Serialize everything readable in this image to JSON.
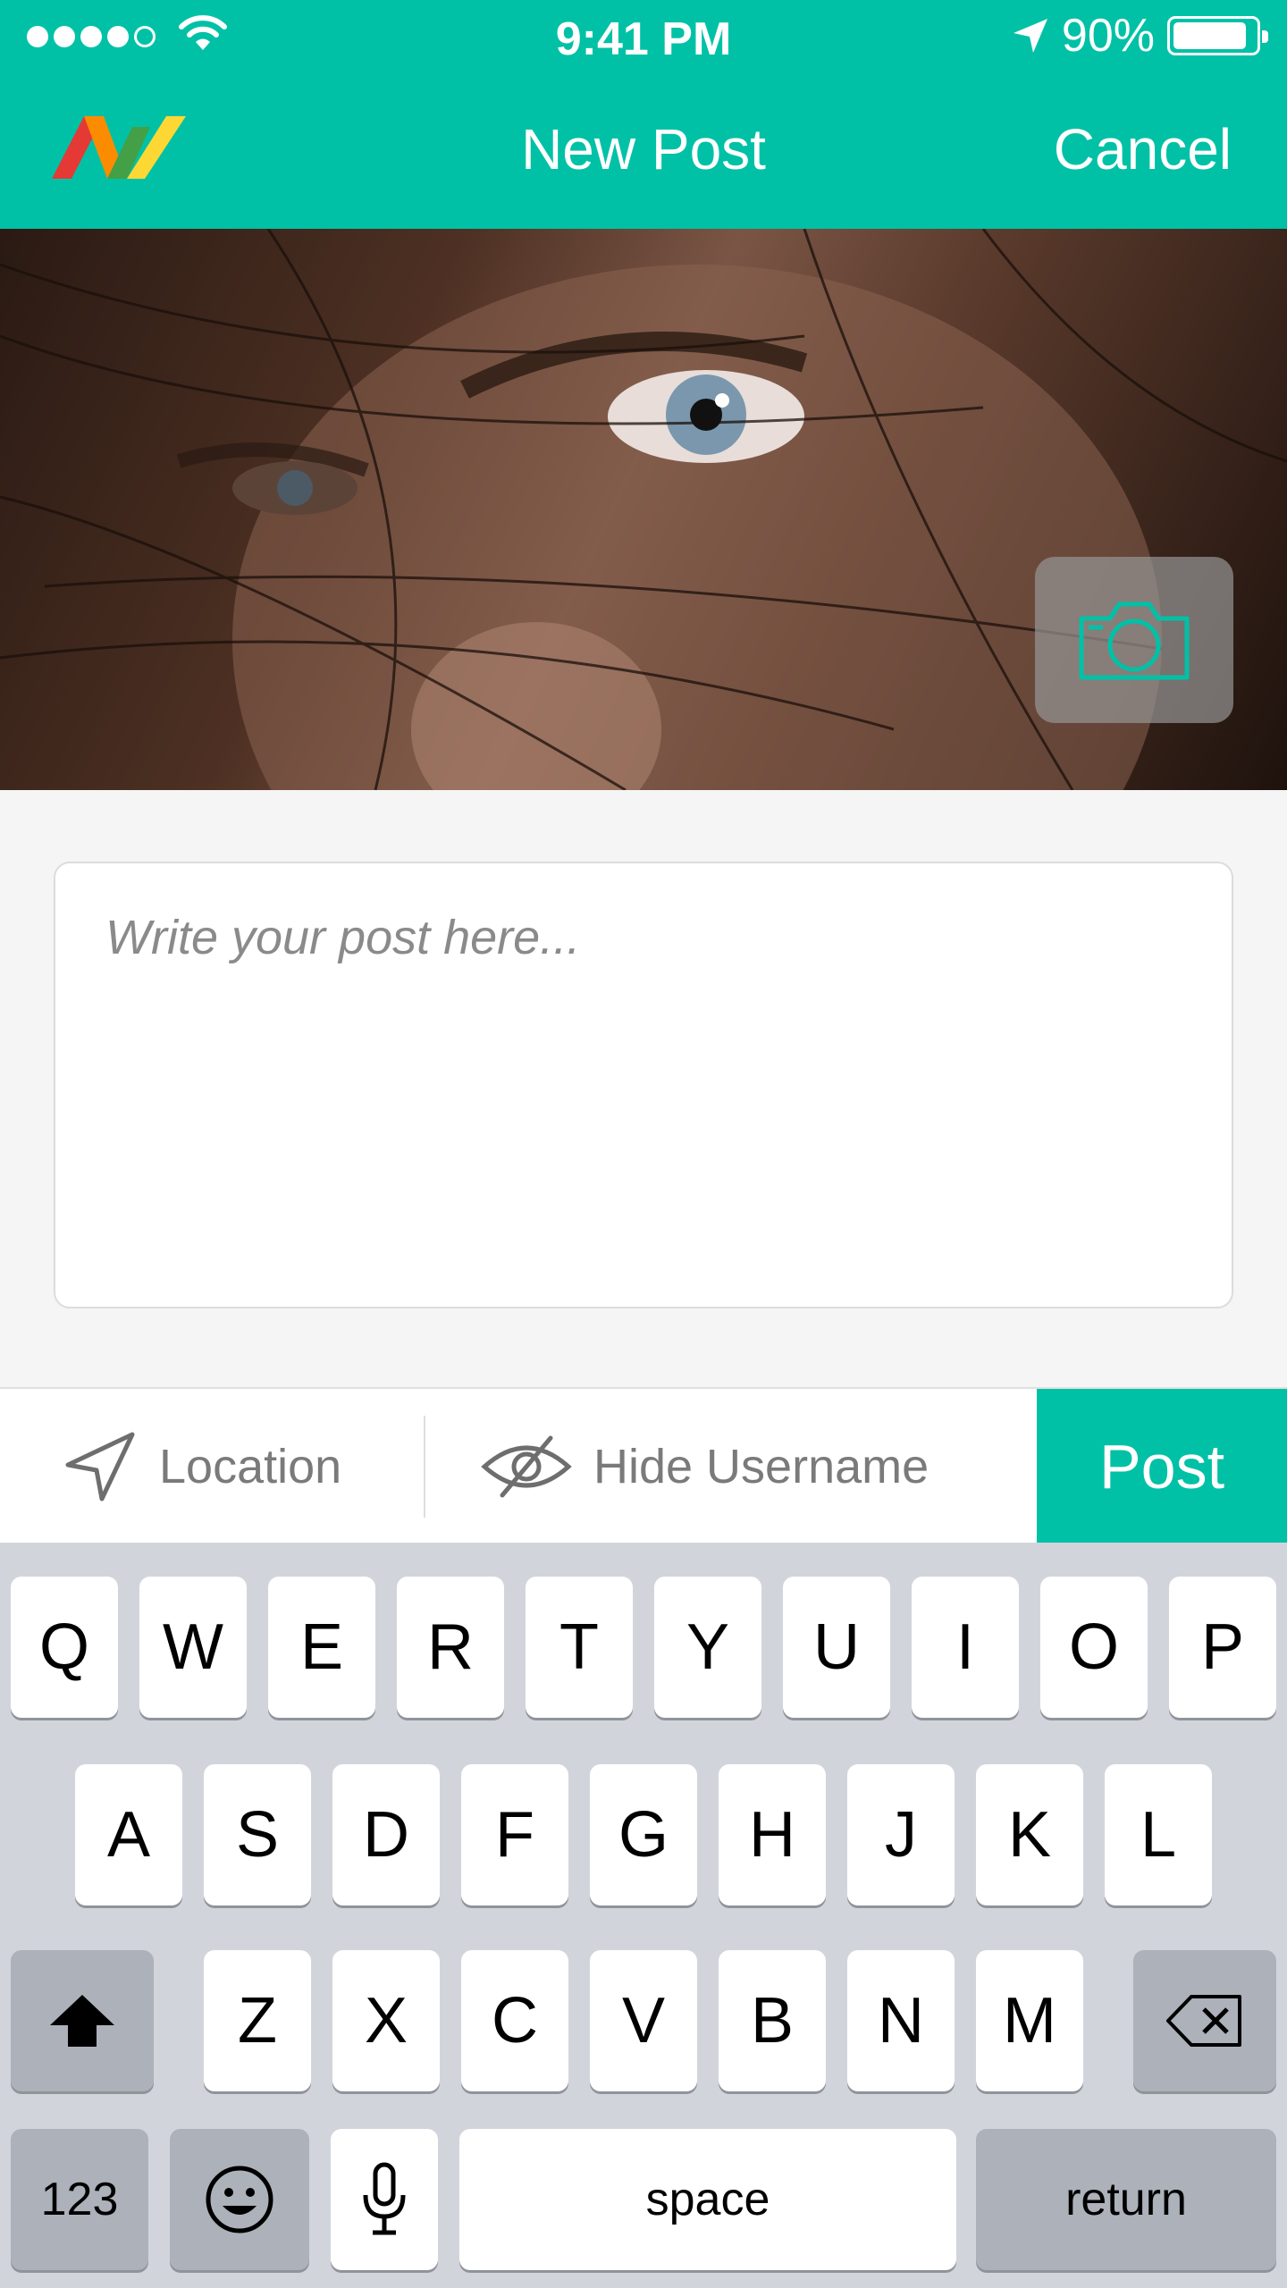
{
  "status_bar": {
    "time": "9:41 PM",
    "battery": "90%",
    "battery_level": 0.9
  },
  "nav": {
    "title": "New Post",
    "cancel_label": "Cancel",
    "logo_icon": "av-logo-icon"
  },
  "composer": {
    "placeholder": "Write your post here..."
  },
  "actions": {
    "location_label": "Location",
    "hide_username_label": "Hide Username",
    "post_label": "Post"
  },
  "keyboard": {
    "row1": [
      "Q",
      "W",
      "E",
      "R",
      "T",
      "Y",
      "U",
      "I",
      "O",
      "P"
    ],
    "row2": [
      "A",
      "S",
      "D",
      "F",
      "G",
      "H",
      "J",
      "K",
      "L"
    ],
    "row3": [
      "Z",
      "X",
      "C",
      "V",
      "B",
      "N",
      "M"
    ],
    "numbers_label": "123",
    "space_label": "space",
    "return_label": "return"
  },
  "colors": {
    "accent": "#00c1a6",
    "keyboard_bg": "#d1d5db"
  }
}
